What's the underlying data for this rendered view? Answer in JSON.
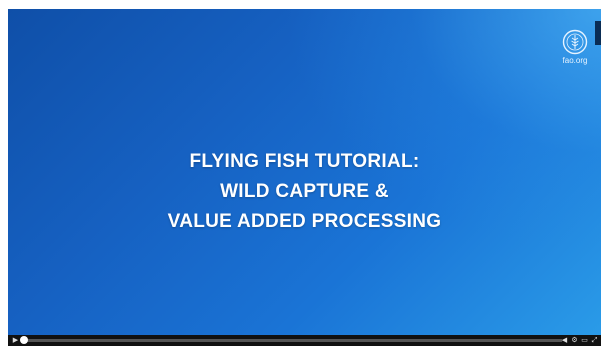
{
  "video": {
    "title_lines": [
      "FLYING FISH TUTORIAL:",
      "WILD CAPTURE &",
      "VALUE ADDED PROCESSING"
    ],
    "logo_text": "fao.org",
    "logo_icon": "fao-emblem-icon",
    "colors": {
      "background_dark": "#0f4fa8",
      "background_light": "#2a9be8",
      "title_text": "#ffffff"
    }
  },
  "controls": {
    "play_icon": "▶",
    "progress": 0.0,
    "icons": [
      "volume-icon",
      "settings-icon",
      "fullscreen-icon",
      "expand-icon"
    ],
    "icon_glyphs": [
      "◀",
      "⚙",
      "▭",
      "⤢"
    ]
  }
}
